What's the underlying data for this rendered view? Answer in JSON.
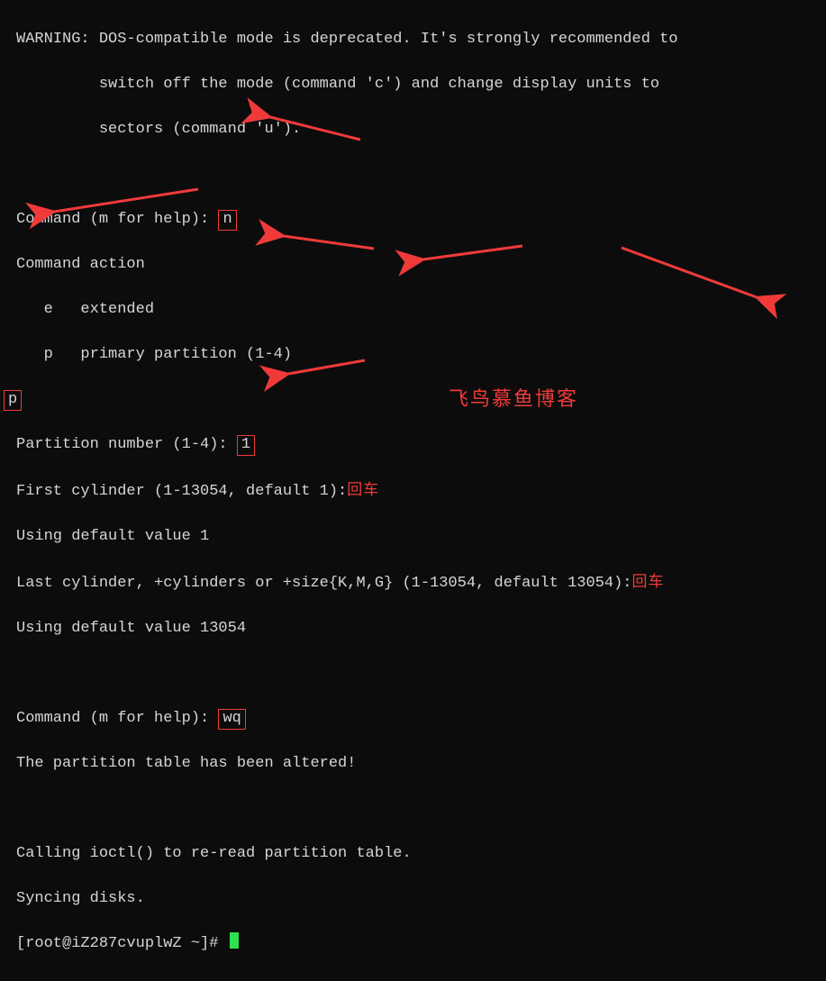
{
  "warning": {
    "l1": "WARNING: DOS-compatible mode is deprecated. It's strongly recommended to",
    "l2": "         switch off the mode (command 'c') and change display units to",
    "l3": "         sectors (command 'u')."
  },
  "cmd1_prompt": "Command (m for help): ",
  "cmd1_input": "n",
  "action_header": "Command action",
  "action_e": "   e   extended",
  "action_p": "   p   primary partition (1-4)",
  "p_input": "p",
  "partnum_prompt": "Partition number (1-4): ",
  "partnum_input": "1",
  "firstcyl_prompt": "First cylinder (1-13054, default 1):",
  "enter_label": "回车",
  "default1": "Using default value 1",
  "lastcyl_prompt": "Last cylinder, +cylinders or +size{K,M,G} (1-13054, default 13054):",
  "default13054": "Using default value 13054",
  "cmd2_prompt": "Command (m for help): ",
  "cmd2_input": "wq",
  "altered": "The partition table has been altered!",
  "ioctl": "Calling ioctl() to re-read partition table.",
  "syncing": "Syncing disks.",
  "shell_prompt": "[root@iZ287cvuplwZ ~]# ",
  "watermark": "飞鸟慕鱼博客",
  "colors": {
    "accent": "#f03a3a",
    "cursor": "#2fe24d"
  }
}
